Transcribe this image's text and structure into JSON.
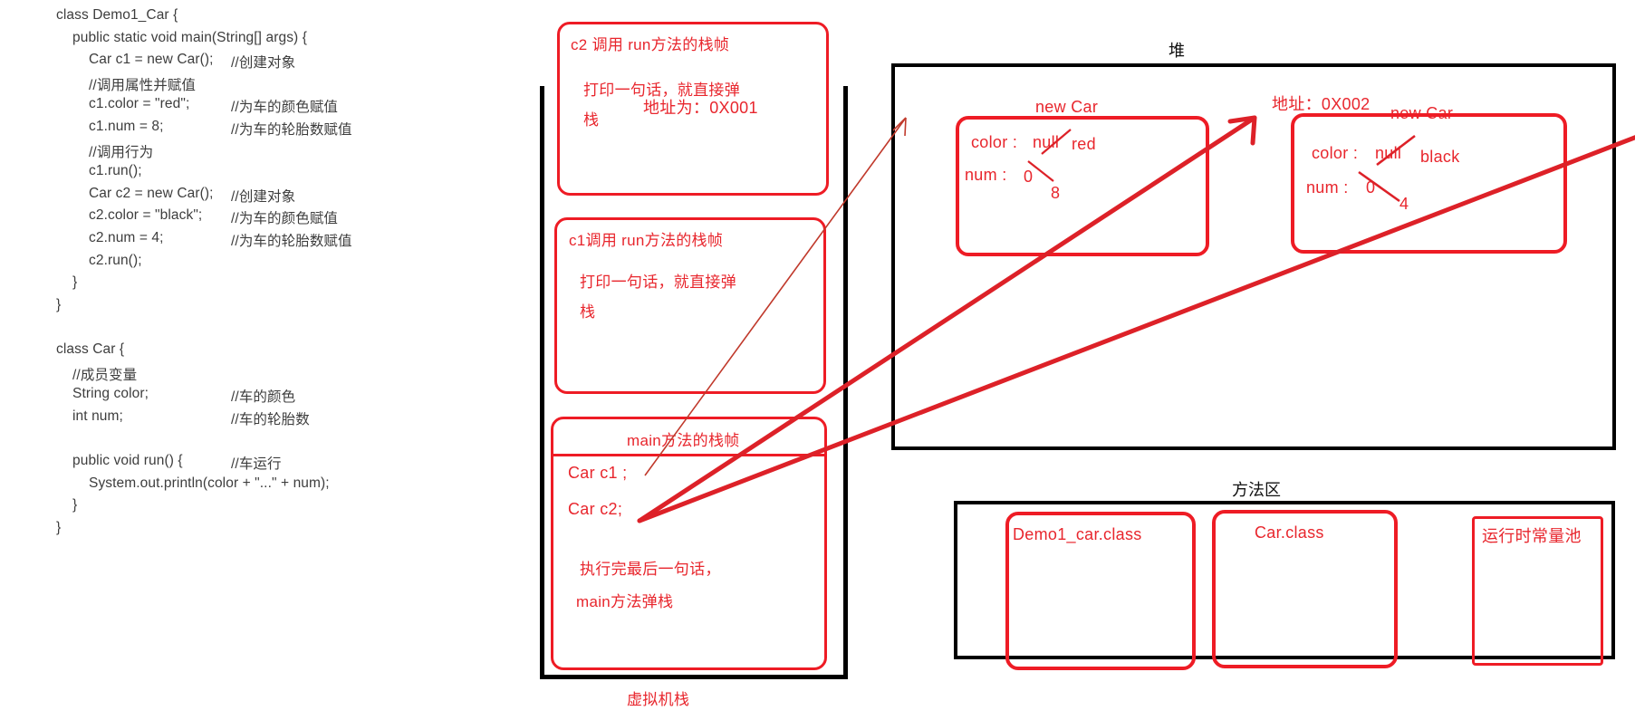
{
  "code": {
    "lines": [
      {
        "indent": 0,
        "text": "class Demo1_Car {",
        "comment": ""
      },
      {
        "indent": 1,
        "text": "public static void main(String[] args) {",
        "comment": ""
      },
      {
        "indent": 2,
        "text": "Car c1 = new Car();",
        "comment": "//创建对象"
      },
      {
        "indent": 2,
        "text": "//调用属性并赋值",
        "comment": ""
      },
      {
        "indent": 2,
        "text": "c1.color = \"red\";",
        "comment": "//为车的颜色赋值"
      },
      {
        "indent": 2,
        "text": "c1.num = 8;",
        "comment": "//为车的轮胎数赋值"
      },
      {
        "indent": 2,
        "text": "//调用行为",
        "comment": ""
      },
      {
        "indent": 2,
        "text": "c1.run();",
        "comment": ""
      },
      {
        "indent": 2,
        "text": "Car c2 = new Car();",
        "comment": "//创建对象"
      },
      {
        "indent": 2,
        "text": "c2.color = \"black\";",
        "comment": "//为车的颜色赋值"
      },
      {
        "indent": 2,
        "text": "c2.num = 4;",
        "comment": "//为车的轮胎数赋值"
      },
      {
        "indent": 2,
        "text": "c2.run();",
        "comment": ""
      },
      {
        "indent": 1,
        "text": "}",
        "comment": ""
      },
      {
        "indent": 0,
        "text": "}",
        "comment": ""
      },
      {
        "indent": 0,
        "text": "",
        "comment": ""
      },
      {
        "indent": 0,
        "text": "class Car {",
        "comment": ""
      },
      {
        "indent": 1,
        "text": "//成员变量",
        "comment": ""
      },
      {
        "indent": 1,
        "text": "String color;",
        "comment": "//车的颜色"
      },
      {
        "indent": 1,
        "text": "int num;",
        "comment": "//车的轮胎数"
      },
      {
        "indent": 1,
        "text": "",
        "comment": ""
      },
      {
        "indent": 1,
        "text": "public void run() {",
        "comment": "//车运行"
      },
      {
        "indent": 2,
        "text": "System.out.println(color + \"...\" + num);",
        "comment": ""
      },
      {
        "indent": 1,
        "text": "}",
        "comment": ""
      },
      {
        "indent": 0,
        "text": "}",
        "comment": ""
      }
    ]
  },
  "stack": {
    "area_label": "虚拟机栈",
    "frames": [
      {
        "id": "frame-c2-run",
        "title": "c2 调用 run方法的栈帧",
        "body_line1": "打印一句话，就直接弹",
        "body_line2": "栈"
      },
      {
        "id": "frame-c1-run",
        "title": "c1调用 run方法的栈帧",
        "body_line1": "打印一句话，就直接弹",
        "body_line2": "栈"
      },
      {
        "id": "frame-main",
        "title": "main方法的栈帧",
        "var1": "Car c1 ;",
        "var2": "Car c2;",
        "note_line1": "执行完最后一句话，",
        "note_line2": "main方法弹栈"
      }
    ]
  },
  "heap": {
    "title": "堆",
    "objects": [
      {
        "id": "heap-object-1",
        "address_label": "地址为：0X001",
        "type_label": "new Car",
        "fields": [
          {
            "name": "color :",
            "old_value": "null",
            "new_value": "red"
          },
          {
            "name": "num :",
            "old_value": "0",
            "new_value": "8"
          }
        ]
      },
      {
        "id": "heap-object-2",
        "address_label": "地址：0X002",
        "type_label": "new Car",
        "fields": [
          {
            "name": "color :",
            "old_value": "null",
            "new_value": "black"
          },
          {
            "name": "num :",
            "old_value": "0",
            "new_value": "4"
          }
        ]
      }
    ]
  },
  "method_area": {
    "title": "方法区",
    "items": [
      {
        "id": "method-area-demo1-car-class",
        "label": "Demo1_car.class"
      },
      {
        "id": "method-area-car-class",
        "label": "Car.class"
      },
      {
        "id": "method-area-runtime-constant-pool",
        "label": "运行时常量池"
      }
    ]
  },
  "colors": {
    "annotation_red": "#e8262d",
    "frame_black": "#000000",
    "code_gray": "#3d3d3d"
  }
}
